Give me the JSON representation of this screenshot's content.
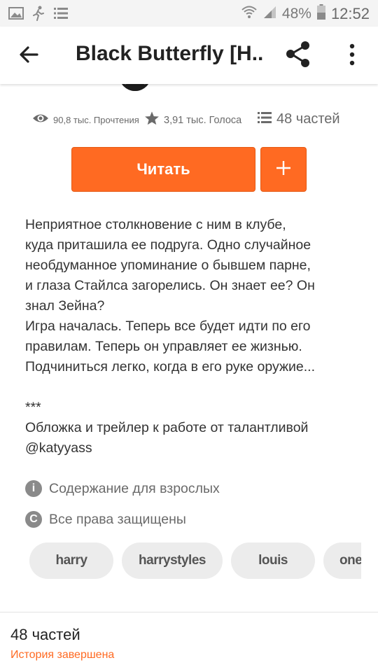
{
  "status_bar": {
    "battery_percent": "48%",
    "time": "12:52"
  },
  "app_bar": {
    "title": "Black Butterfly [H..."
  },
  "stats": {
    "reads": "90,8 тыс. Прочтения",
    "votes": "3,91 тыс. Голоса",
    "parts": "48 частей"
  },
  "actions": {
    "read_label": "Читать",
    "add_label": "+"
  },
  "description": [
    "Неприятное столкновение с ним в клубе,",
    "куда приташила ее подруга. Одно случайное",
    "необдуманное упоминание о бывшем парне,",
    "и глаза Стайлса загорелись. Он знает ее? Он",
    "знал Зейна?",
    "Игра началась. Теперь все будет идти по его",
    "правилам. Теперь он управляет ее жизнью.",
    "Подчиниться легко, когда в его руке оружие...",
    "",
    "***",
    "Обложка и трейлер к работе от талантливой",
    "@katyyass"
  ],
  "info": {
    "mature": "Содержание для взрослых",
    "copyright": "Все права защищены"
  },
  "tags": [
    "harry",
    "harrystyles",
    "louis",
    "one"
  ],
  "bottom": {
    "parts_title": "48 частей",
    "story_status": "История завершена"
  },
  "colors": {
    "accent": "#ff6a22",
    "status_bar_bg": "#f4f4f4",
    "tag_bg": "#ececec"
  },
  "icons": [
    "image-icon",
    "runner-icon",
    "list-notification-icon",
    "wifi-icon",
    "signal-icon",
    "battery-icon",
    "back-arrow-icon",
    "share-icon",
    "more-vert-icon",
    "eye-icon",
    "star-icon",
    "list-icon",
    "info-icon",
    "copyright-icon"
  ]
}
